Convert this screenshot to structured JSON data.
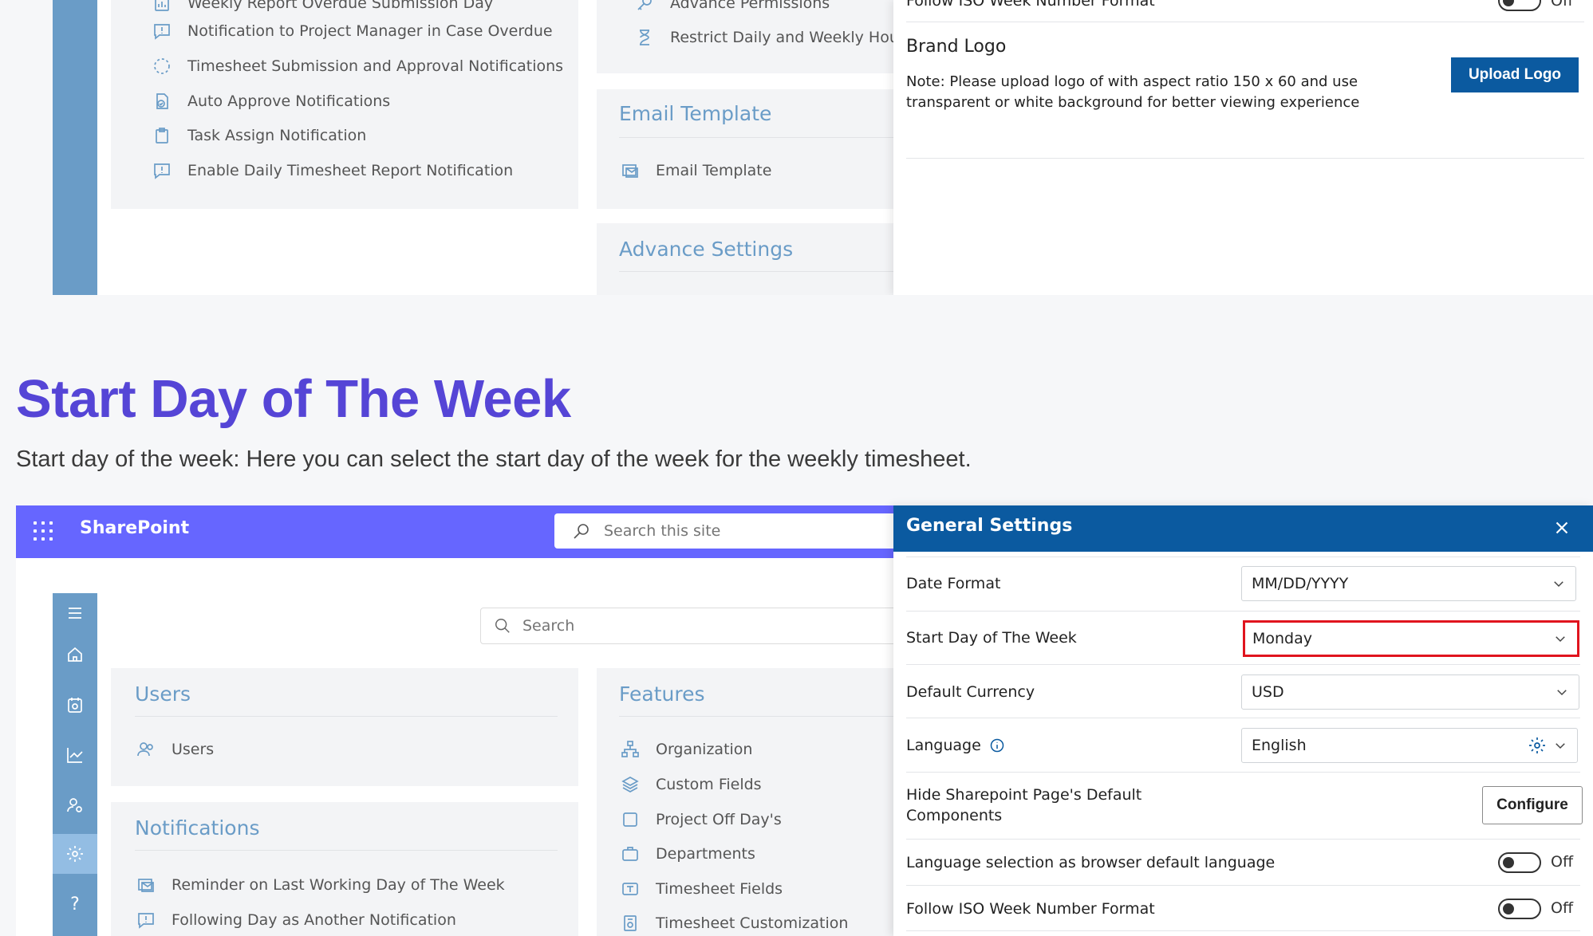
{
  "top": {
    "notifications_items": [
      {
        "label": "Weekly Report Overdue Submission Day",
        "icon": "report-icon"
      },
      {
        "label": "Notification to Project Manager in Case Overdue",
        "icon": "chat-alert-icon"
      },
      {
        "label": "Timesheet Submission and Approval Notifications",
        "icon": "dotted-circle-icon"
      },
      {
        "label": "Auto Approve Notifications",
        "icon": "approve-doc-icon"
      },
      {
        "label": "Task Assign Notification",
        "icon": "clipboard-icon"
      },
      {
        "label": "Enable Daily Timesheet Report Notification",
        "icon": "chat-alert-icon"
      }
    ],
    "features_items": [
      {
        "label": "Advance Permissions",
        "icon": "key-icon"
      },
      {
        "label": "Restrict Daily and Weekly Hours",
        "icon": "hourglass-icon"
      }
    ],
    "email_template_title": "Email Template",
    "email_template_item": "Email Template",
    "advance_settings_title": "Advance Settings",
    "panel": {
      "iso_label": "Follow ISO Week Number Format",
      "iso_state": "Off",
      "brand_logo_title": "Brand Logo",
      "brand_logo_note": "Note: Please upload logo of with aspect ratio 150 x 60 and use transparent or white background for better viewing experience",
      "upload_button": "Upload Logo"
    }
  },
  "heading": {
    "title": "Start Day of The Week",
    "description": "Start day of the week: Here you can select the start day of the week for the weekly timesheet."
  },
  "sharepoint": {
    "brand": "SharePoint",
    "search_placeholder": "Search this site",
    "inner_search_placeholder": "Search",
    "users_title": "Users",
    "users_item": "Users",
    "notifications_title": "Notifications",
    "notifications_items": [
      "Reminder on Last Working Day of The Week",
      "Following Day as Another Notification"
    ],
    "features_title": "Features",
    "features_items": [
      {
        "label": "Organization",
        "icon": "org-chart-icon"
      },
      {
        "label": "Custom Fields",
        "icon": "layers-icon"
      },
      {
        "label": "Project Off Day's",
        "icon": "square-icon"
      },
      {
        "label": "Departments",
        "icon": "briefcase-icon"
      },
      {
        "label": "Timesheet Fields",
        "icon": "text-field-icon"
      },
      {
        "label": "Timesheet Customization",
        "icon": "customize-icon"
      }
    ],
    "rail_icons": [
      "menu-icon",
      "home-icon",
      "timesheet-icon",
      "chart-icon",
      "user-settings-icon",
      "gear-icon",
      "help-icon"
    ],
    "help_glyph": "?"
  },
  "general_settings": {
    "title": "General Settings",
    "date_format_label": "Date Format",
    "date_format_value": "MM/DD/YYYY",
    "start_day_label": "Start Day of The Week",
    "start_day_value": "Monday",
    "currency_label": "Default Currency",
    "currency_value": "USD",
    "language_label": "Language",
    "language_value": "English",
    "hide_components_label": "Hide Sharepoint Page's Default Components",
    "configure_button": "Configure",
    "browser_language_label": "Language selection as browser default language",
    "browser_language_state": "Off",
    "iso_label": "Follow ISO Week Number Format",
    "iso_state": "Off"
  },
  "colors": {
    "heading": "#5545d6",
    "suitebar": "#6666ff",
    "panel_header": "#0b5aa0",
    "rail": "#6a9cc7",
    "highlight": "#e0141e"
  }
}
